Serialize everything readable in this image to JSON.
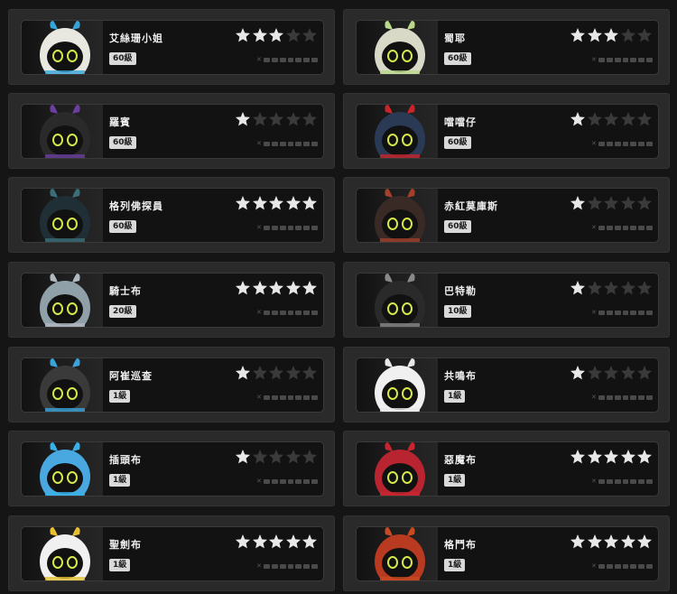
{
  "characters": [
    {
      "name": "艾絲珊小姐",
      "level": "60級",
      "stars": 3,
      "accent": "#36a3d9",
      "body": "#e8e8e0"
    },
    {
      "name": "蜀耶",
      "level": "60級",
      "stars": 3,
      "accent": "#b9d88a",
      "body": "#d9d9c8"
    },
    {
      "name": "羅賓",
      "level": "60級",
      "stars": 1,
      "accent": "#6a3fa0",
      "body": "#2a2a2a"
    },
    {
      "name": "噹噹仔",
      "level": "60級",
      "stars": 1,
      "accent": "#c8252a",
      "body": "#2a3a55"
    },
    {
      "name": "格列佛探員",
      "level": "60級",
      "stars": 5,
      "accent": "#3a6e78",
      "body": "#1f2f35"
    },
    {
      "name": "赤紅莫庫斯",
      "level": "60級",
      "stars": 1,
      "accent": "#a3402a",
      "body": "#3a2a25"
    },
    {
      "name": "騎士布",
      "level": "20級",
      "stars": 5,
      "accent": "#b0b8c0",
      "body": "#8fa0a8"
    },
    {
      "name": "巴特勒",
      "level": "10級",
      "stars": 1,
      "accent": "#888888",
      "body": "#2a2a2a"
    },
    {
      "name": "阿崔巡查",
      "level": "1級",
      "stars": 1,
      "accent": "#3aa3d9",
      "body": "#3a3a3a"
    },
    {
      "name": "共鳴布",
      "level": "1級",
      "stars": 1,
      "accent": "#e8e8e8",
      "body": "#f0f0f0"
    },
    {
      "name": "插頭布",
      "level": "1級",
      "stars": 1,
      "accent": "#3ab0e8",
      "body": "#4aa8e0"
    },
    {
      "name": "惡魔布",
      "level": "1級",
      "stars": 5,
      "accent": "#c82530",
      "body": "#b82530"
    },
    {
      "name": "聖劍布",
      "level": "1級",
      "stars": 5,
      "accent": "#e8c030",
      "body": "#f0f0f0"
    },
    {
      "name": "格鬥布",
      "level": "1級",
      "stars": 5,
      "accent": "#c84a20",
      "body": "#b83a20"
    }
  ],
  "colors": {
    "star_filled": "#e8e8e8",
    "star_empty": "#3a3a3a"
  }
}
